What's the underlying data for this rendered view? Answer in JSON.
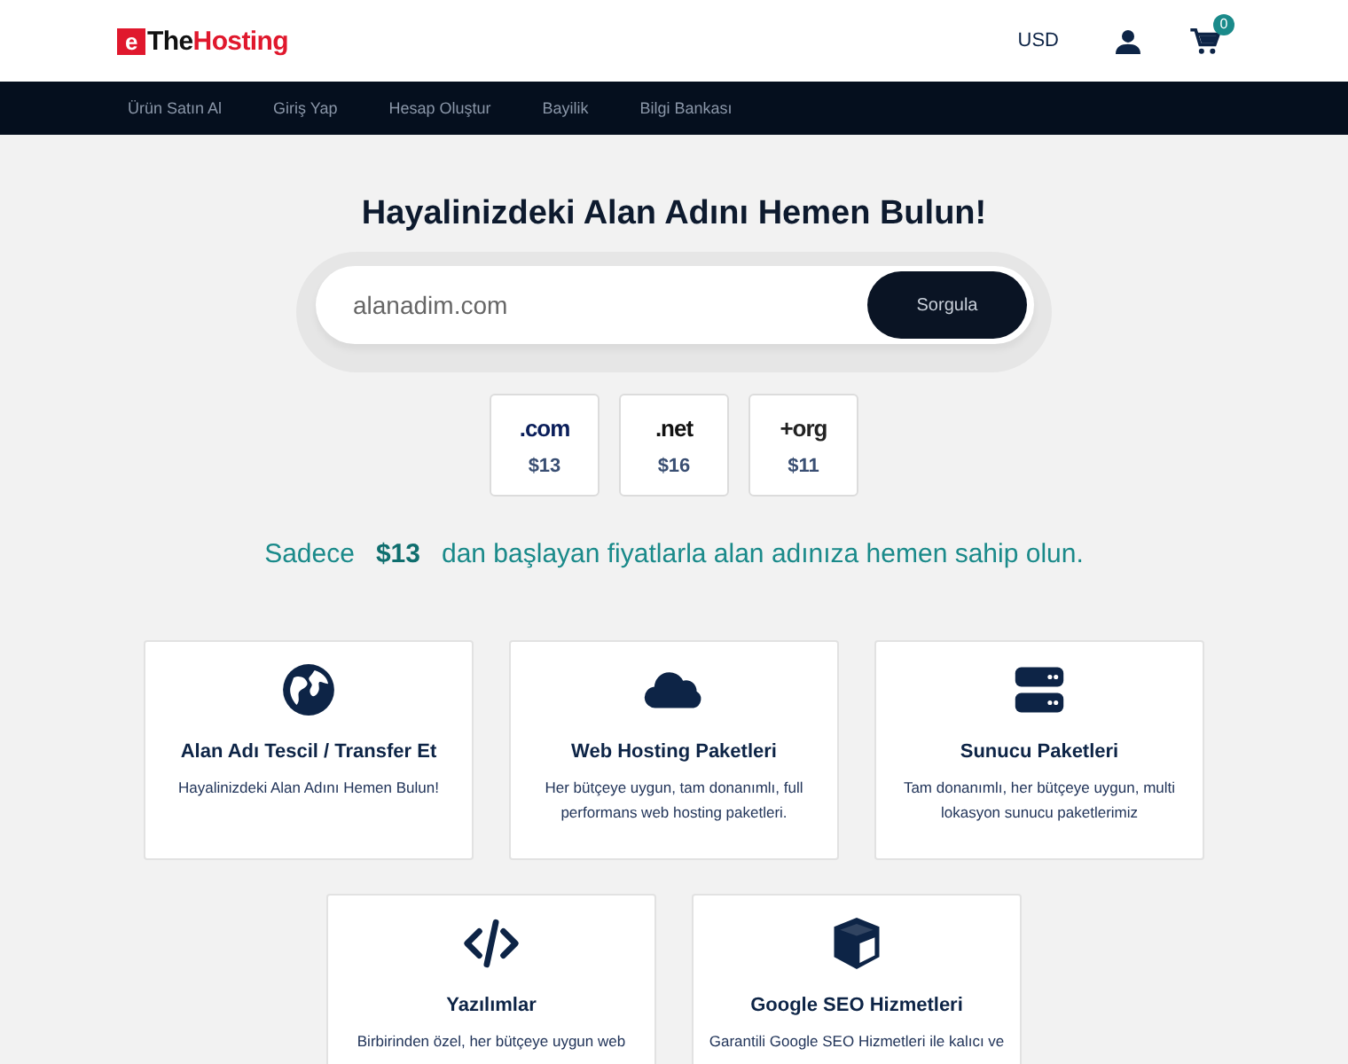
{
  "header": {
    "logo": {
      "mark": "e",
      "text": "The",
      "accent": "Hosting"
    },
    "currency": "USD",
    "cart_count": "0"
  },
  "nav": [
    "Ürün Satın Al",
    "Giriş Yap",
    "Hesap Oluştur",
    "Bayilik",
    "Bilgi Bankası"
  ],
  "hero": {
    "title": "Hayalinizdeki Alan Adını Hemen Bulun!",
    "search": {
      "placeholder": "alanadim.com",
      "button": "Sorgula"
    },
    "tlds": [
      {
        "kind": "com",
        "label": ".com",
        "price": "$13"
      },
      {
        "kind": "net",
        "label": ".net",
        "price": "$16"
      },
      {
        "kind": "org",
        "label": "+org",
        "price": "$11"
      }
    ],
    "tagline": {
      "before": "Sadece",
      "price": "$13",
      "after": "dan başlayan fiyatlarla alan adınıza hemen sahip olun."
    }
  },
  "services": [
    {
      "kind": "globe",
      "title": "Alan Adı Tescil / Transfer Et",
      "text": "Hayalinizdeki Alan Adını Hemen Bulun!"
    },
    {
      "kind": "cloud",
      "title": "Web Hosting Paketleri",
      "text": "Her bütçeye uygun, tam donanımlı, full performans web hosting paketleri."
    },
    {
      "kind": "server",
      "title": "Sunucu Paketleri",
      "text": "Tam donanımlı, her bütçeye uygun, multi lokasyon sunucu paketlerimiz"
    },
    {
      "kind": "code",
      "title": "Yazılımlar",
      "text": "Birbirinden özel, her bütçeye uygun web"
    },
    {
      "kind": "cube",
      "title": "Google SEO Hizmetleri",
      "text": "Garantili Google SEO Hizmetleri ile kalıcı ve"
    }
  ]
}
